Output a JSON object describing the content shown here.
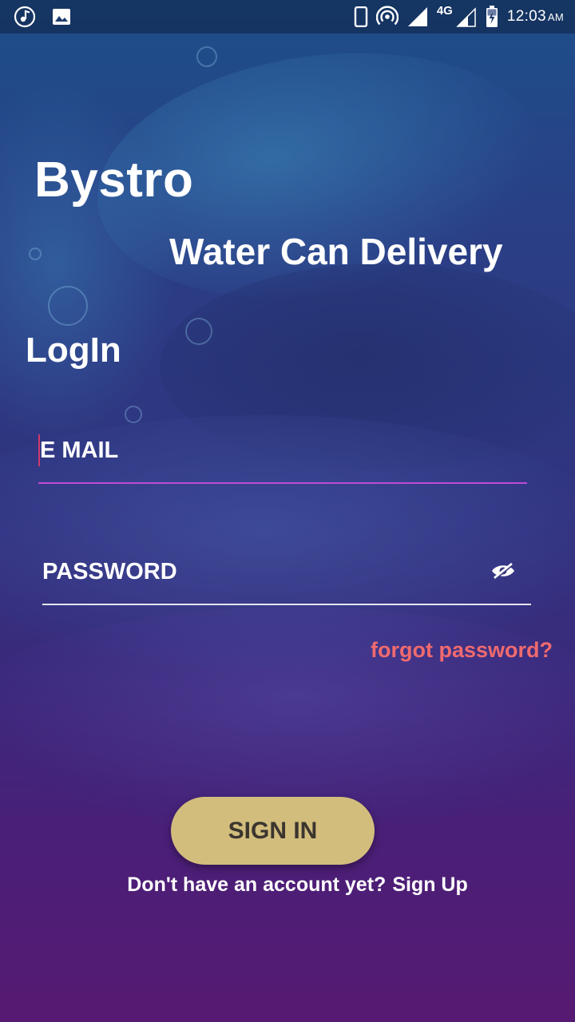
{
  "status_bar": {
    "time": "12:03",
    "ampm": "AM",
    "network": "4G",
    "icons": [
      "music-note-icon",
      "gallery-icon",
      "phone-icon",
      "hotspot-icon",
      "signal-icon",
      "signal-icon",
      "battery-charging-icon"
    ]
  },
  "header": {
    "title": "Bystro",
    "subtitle": "Water Can Delivery"
  },
  "login": {
    "section_title": "LogIn",
    "email_placeholder": "E MAIL",
    "email_value": "",
    "password_placeholder": "PASSWORD",
    "password_value": "",
    "forgot_label": "forgot password?",
    "signin_label": "SIGN IN",
    "signup_prompt": "Don't have an account yet?",
    "signup_link": "Sign Up"
  },
  "colors": {
    "accent_underline": "#c04bd6",
    "forgot_link": "#f06a6e",
    "button_bg": "#d2bd7d",
    "button_text": "#3b352e"
  }
}
